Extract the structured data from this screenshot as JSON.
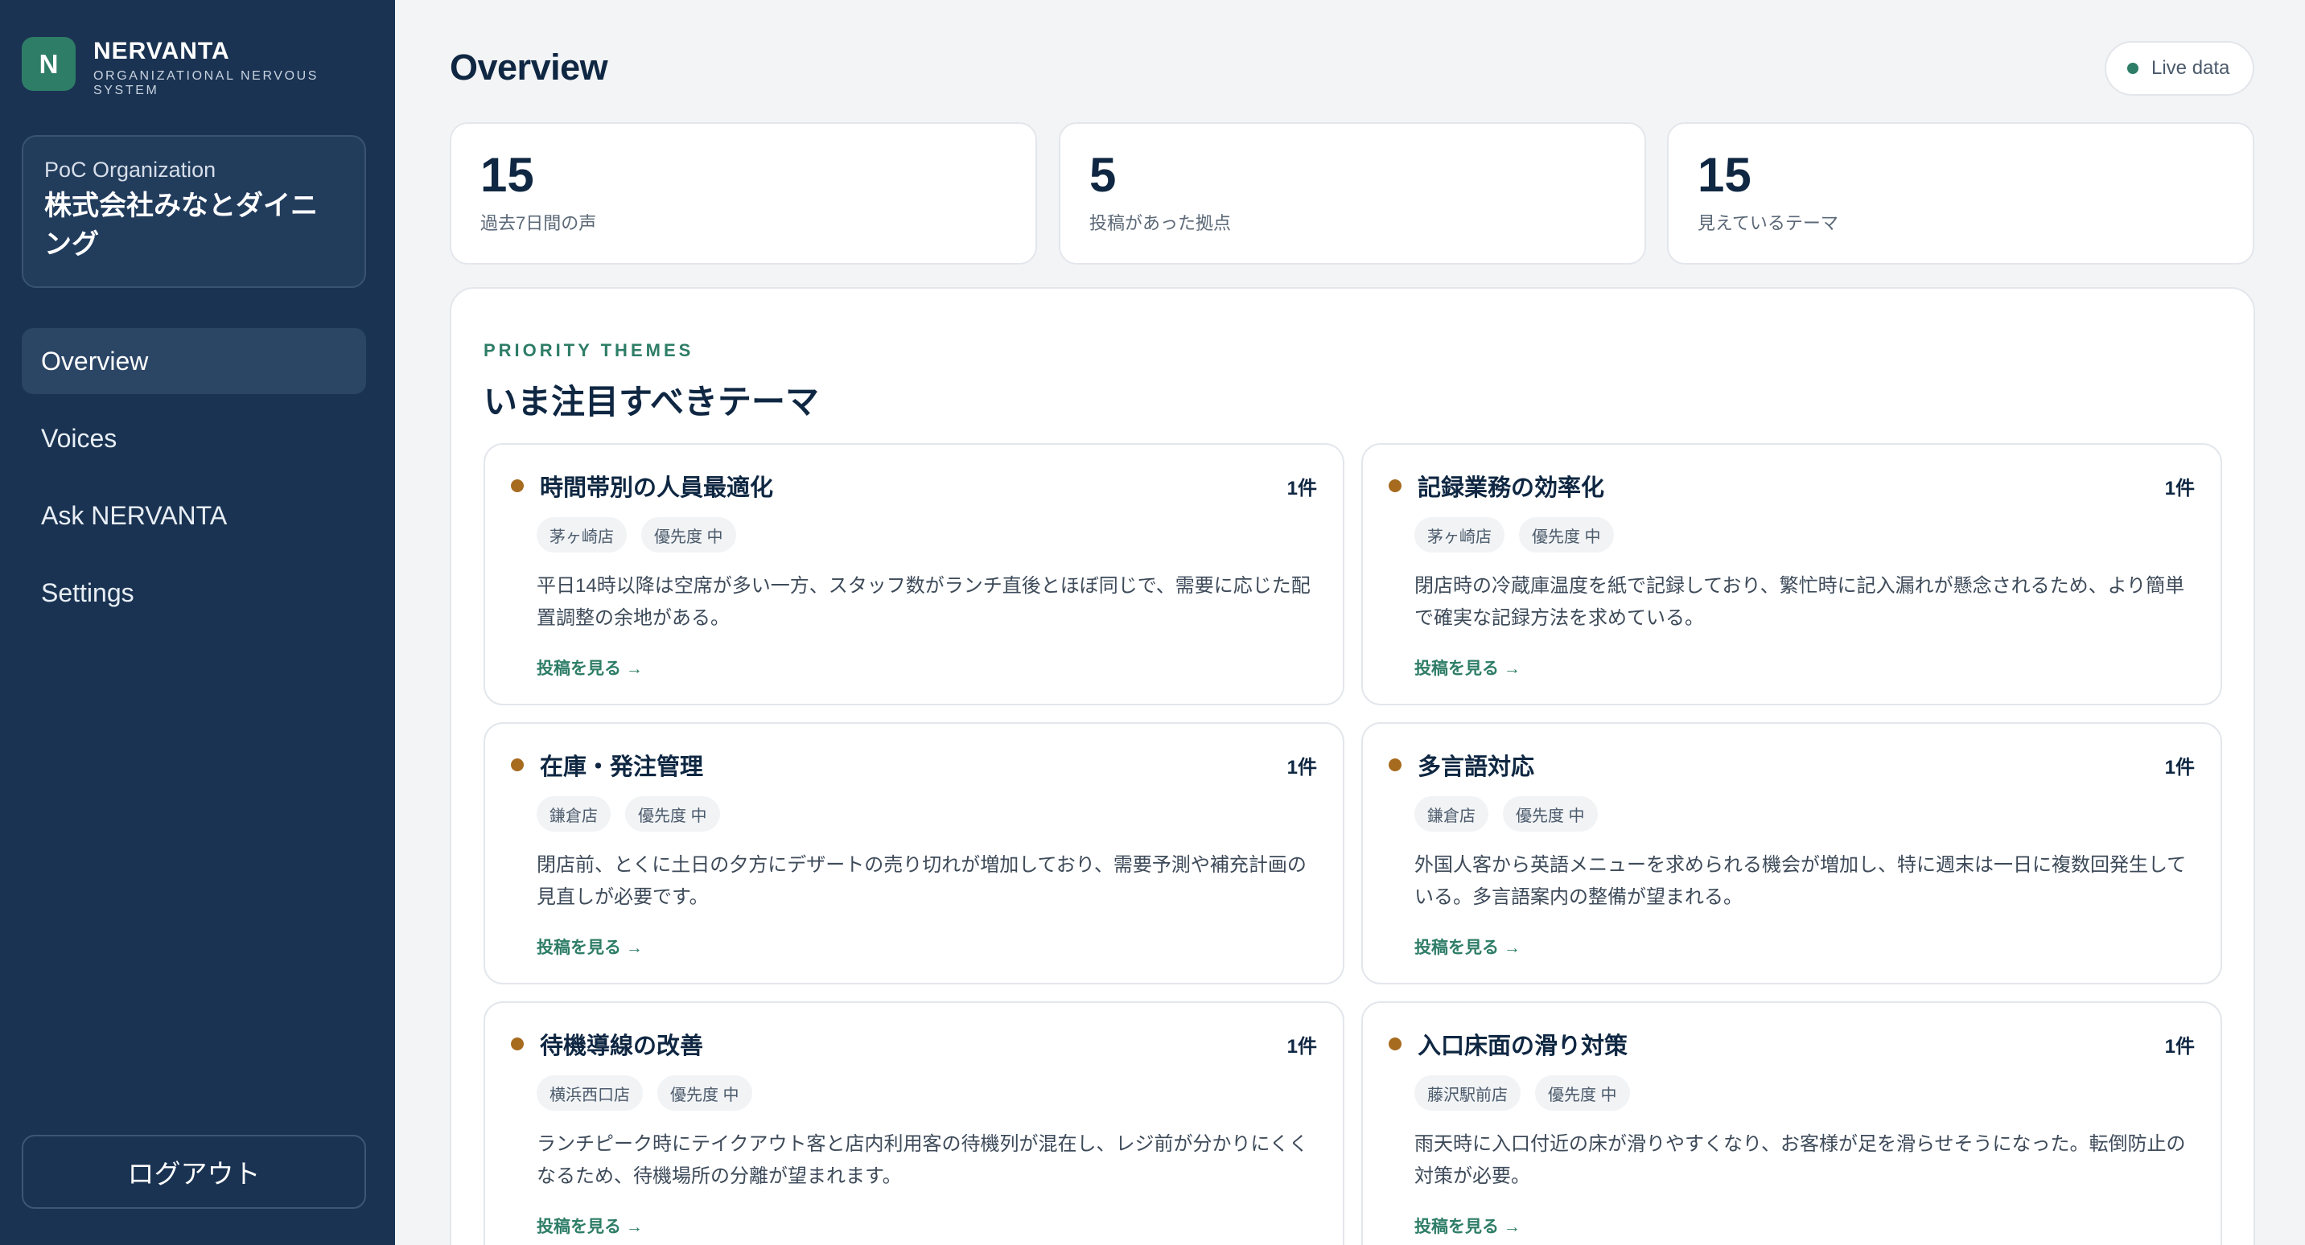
{
  "brand": {
    "logo_letter": "N",
    "name": "NERVANTA",
    "subtitle": "ORGANIZATIONAL NERVOUS SYSTEM"
  },
  "org": {
    "label": "PoC Organization",
    "name": "株式会社みなとダイニング"
  },
  "nav": {
    "items": [
      {
        "label": "Overview",
        "active": true
      },
      {
        "label": "Voices",
        "active": false
      },
      {
        "label": "Ask NERVANTA",
        "active": false
      },
      {
        "label": "Settings",
        "active": false
      }
    ]
  },
  "logout_label": "ログアウト",
  "header": {
    "title": "Overview",
    "live_label": "Live data"
  },
  "stats": [
    {
      "value": "15",
      "label": "過去7日間の声"
    },
    {
      "value": "5",
      "label": "投稿があった拠点"
    },
    {
      "value": "15",
      "label": "見えているテーマ"
    }
  ],
  "section": {
    "eyebrow": "PRIORITY THEMES",
    "title": "いま注目すべきテーマ"
  },
  "themes": [
    {
      "title": "時間帯別の人員最適化",
      "count": "1件",
      "location": "茅ヶ崎店",
      "priority": "優先度 中",
      "body": "平日14時以降は空席が多い一方、スタッフ数がランチ直後とほぼ同じで、需要に応じた配置調整の余地がある。",
      "link": "投稿を見る →"
    },
    {
      "title": "記録業務の効率化",
      "count": "1件",
      "location": "茅ヶ崎店",
      "priority": "優先度 中",
      "body": "閉店時の冷蔵庫温度を紙で記録しており、繁忙時に記入漏れが懸念されるため、より簡単で確実な記録方法を求めている。",
      "link": "投稿を見る →"
    },
    {
      "title": "在庫・発注管理",
      "count": "1件",
      "location": "鎌倉店",
      "priority": "優先度 中",
      "body": "閉店前、とくに土日の夕方にデザートの売り切れが増加しており、需要予測や補充計画の見直しが必要です。",
      "link": "投稿を見る →"
    },
    {
      "title": "多言語対応",
      "count": "1件",
      "location": "鎌倉店",
      "priority": "優先度 中",
      "body": "外国人客から英語メニューを求められる機会が増加し、特に週末は一日に複数回発生している。多言語案内の整備が望まれる。",
      "link": "投稿を見る →"
    },
    {
      "title": "待機導線の改善",
      "count": "1件",
      "location": "横浜西口店",
      "priority": "優先度 中",
      "body": "ランチピーク時にテイクアウト客と店内利用客の待機列が混在し、レジ前が分かりにくくなるため、待機場所の分離が望まれます。",
      "link": "投稿を見る →"
    },
    {
      "title": "入口床面の滑り対策",
      "count": "1件",
      "location": "藤沢駅前店",
      "priority": "優先度 中",
      "body": "雨天時に入口付近の床が滑りやすくなり、お客様が足を滑らせそうになった。転倒防止の対策が必要。",
      "link": "投稿を見る →"
    }
  ],
  "colors": {
    "sidebar": "#1a3352",
    "accent": "#2e7d67",
    "priority_dot": "#a66b1f"
  }
}
